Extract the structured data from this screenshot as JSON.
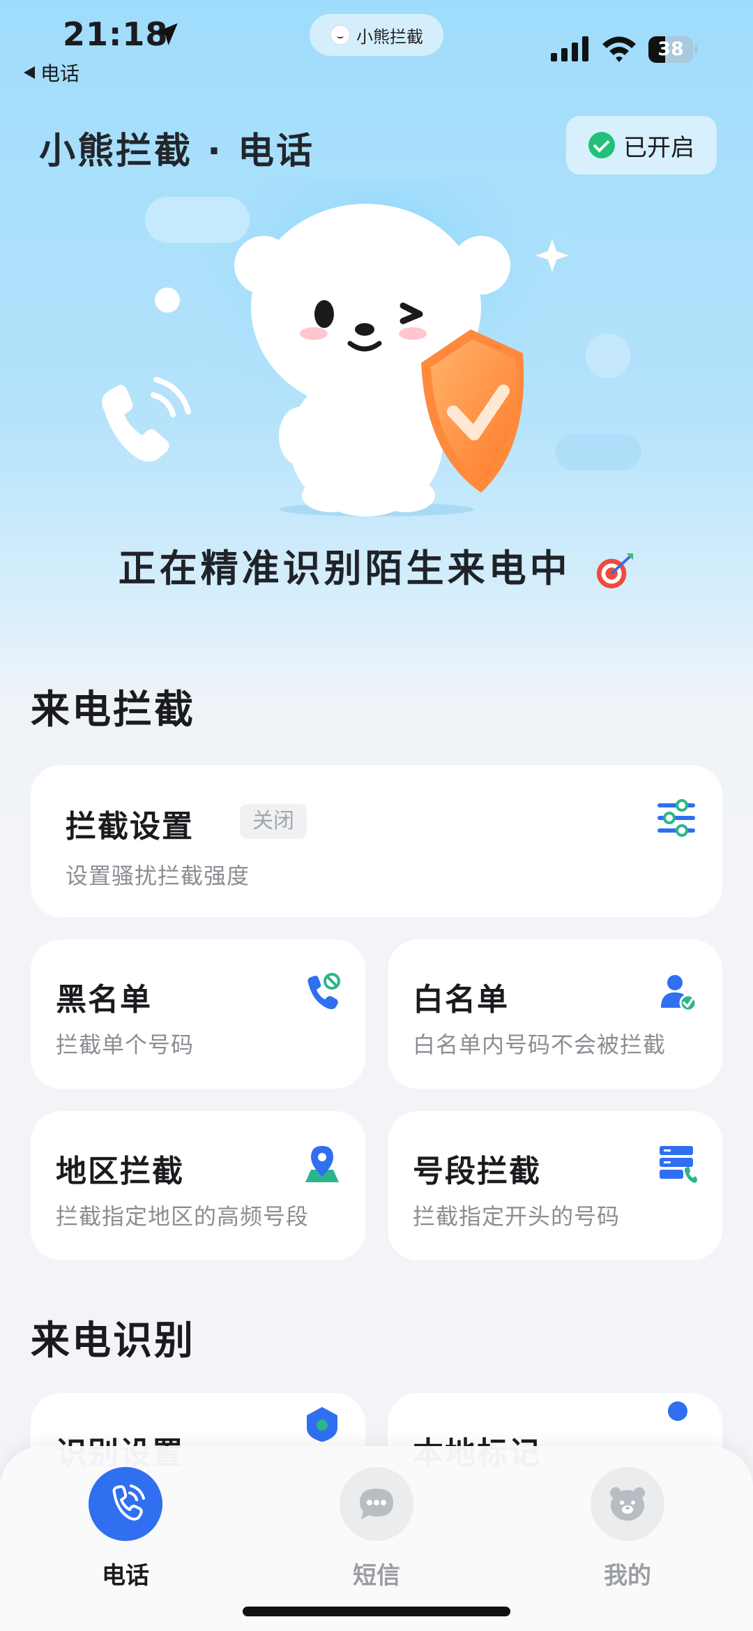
{
  "status_bar": {
    "time": "21:18",
    "back_label": "电话",
    "island_label": "小熊拦截",
    "battery": "38",
    "battery_level": 0.38
  },
  "header": {
    "title": "小熊拦截 · 电话",
    "status_label": "已开启",
    "status_color": "#22c07a"
  },
  "hero": {
    "caption": "正在精准识别陌生来电中",
    "icons": [
      "bear-mascot",
      "shield-check-icon",
      "phone-ringing-icon",
      "target-icon"
    ]
  },
  "sections": {
    "interception": {
      "title": "来电拦截",
      "settings_card": {
        "title": "拦截设置",
        "badge": "关闭",
        "subtitle": "设置骚扰拦截强度",
        "icon": "sliders-icon"
      },
      "cards": [
        {
          "title": "黑名单",
          "subtitle": "拦截单个号码",
          "icon": "phone-block-icon"
        },
        {
          "title": "白名单",
          "subtitle": "白名单内号码不会被拦截",
          "icon": "user-check-icon"
        },
        {
          "title": "地区拦截",
          "subtitle": "拦截指定地区的高频号段",
          "icon": "location-pin-icon"
        },
        {
          "title": "号段拦截",
          "subtitle": "拦截指定开头的号码",
          "icon": "number-segment-icon"
        }
      ]
    },
    "recognition": {
      "title": "来电识别",
      "cards": [
        {
          "title": "识别设置",
          "icon": "shield-setting-icon"
        },
        {
          "title": "本地标记",
          "icon": "user-mark-icon"
        }
      ]
    }
  },
  "tab_bar": {
    "tabs": [
      {
        "label": "电话",
        "icon": "phone-tab-icon",
        "active": true
      },
      {
        "label": "短信",
        "icon": "message-tab-icon",
        "active": false
      },
      {
        "label": "我的",
        "icon": "bear-profile-icon",
        "active": false
      }
    ],
    "accent_color": "#2f6ff0"
  }
}
